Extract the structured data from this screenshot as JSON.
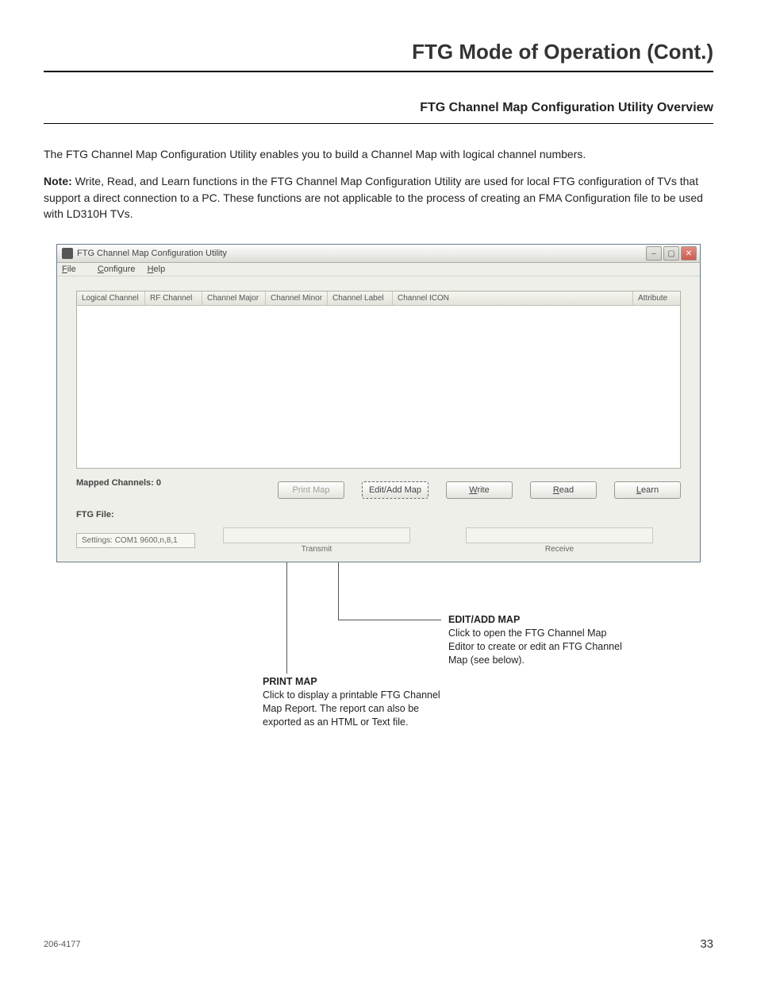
{
  "page": {
    "title": "FTG Mode of Operation (Cont.)",
    "section_title": "FTG Channel Map Configuration Utility Overview",
    "para1": "The FTG Channel Map Configuration Utility enables you to build a Channel Map with logical channel numbers.",
    "note_label": "Note:",
    "note_text": " Write, Read, and Learn functions in the FTG Channel Map Configuration Utility are used for local FTG configuration of TVs that support a direct connection to a PC. These functions are not applicable to the process of creating an FMA Configuration file to be used with LD310H TVs."
  },
  "app": {
    "title": "FTG Channel Map Configuration Utility",
    "menus": {
      "file": "File",
      "configure": "Configure",
      "help": "Help"
    },
    "columns": {
      "logical": "Logical Channel",
      "rf": "RF Channel",
      "major": "Channel Major",
      "minor": "Channel Minor",
      "label": "Channel Label",
      "icon": "Channel ICON",
      "attr": "Attribute"
    },
    "mapped_label": "Mapped Channels: 0",
    "buttons": {
      "print": "Print Map",
      "edit": "Edit/Add Map",
      "write": "Write",
      "read": "Read",
      "learn": "Learn"
    },
    "ftg_file_label": "FTG File:",
    "settings": "Settings: COM1 9600,n,8,1",
    "transmit": "Transmit",
    "receive": "Receive"
  },
  "callouts": {
    "edit_title": "EDIT/ADD MAP",
    "edit_body": "Click to open the FTG Channel Map Editor to create or edit an FTG Channel Map (see below).",
    "print_title": "PRINT MAP",
    "print_body": "Click to display a printable FTG Channel Map Report. The report can also be exported as an HTML or Text file."
  },
  "footer": {
    "left": "206-4177",
    "right": "33"
  }
}
